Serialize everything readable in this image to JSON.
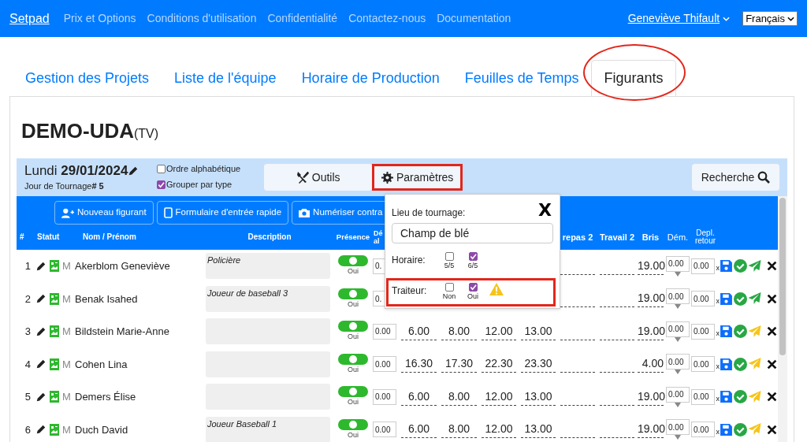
{
  "navbar": {
    "brand": "Setpad",
    "links": [
      "Prix et Options",
      "Conditions d'utilisation",
      "Confidentialité",
      "Contactez-nous",
      "Documentation"
    ],
    "user": "Geneviève Thifault",
    "language": "Français"
  },
  "tabs": [
    {
      "label": "Gestion des Projets",
      "selected": false
    },
    {
      "label": "Liste de l'équipe",
      "selected": false
    },
    {
      "label": "Horaire de Production",
      "selected": false
    },
    {
      "label": "Feuilles de Temps",
      "selected": false
    },
    {
      "label": "Figurants",
      "selected": true,
      "highlighted": true
    }
  ],
  "project": {
    "title": "DEMO-UDA",
    "type": "(TV)"
  },
  "day": {
    "date": "Lundi **29/01/2024**",
    "shoot_day": "Jour de Tournage**# 5**",
    "options": [
      {
        "label": "Ordre alphabétique",
        "checked": false
      },
      {
        "label": "Grouper par type",
        "checked": true
      }
    ]
  },
  "buttons": [
    {
      "kind": "tools",
      "label": "Outils",
      "highlighted": false
    },
    {
      "kind": "settings",
      "label": "Paramètres",
      "highlighted": true
    },
    {
      "kind": "search",
      "label": "Recherche",
      "highlighted": false
    }
  ],
  "toolbar": [
    {
      "kind": "add",
      "label": "Nouveau figurant"
    },
    {
      "kind": "tablet",
      "label": "Formulaire d'entrée rapide"
    },
    {
      "kind": "camera",
      "label": "Numériser contra"
    }
  ],
  "columns": [
    "#",
    "Statut",
    "Nom / Prénom",
    "Description",
    "Présence",
    "Dé al",
    "",
    "",
    "",
    "",
    "repas 2",
    "Travail 2",
    "Bris",
    "Dém.",
    "Depl. retour"
  ],
  "rows": [
    {
      "number": "1",
      "status": "M",
      "name": "Akerblom Geneviève",
      "description": "Policière",
      "present": true,
      "presence_label": "Oui",
      "start": "0.",
      "times": [],
      "bris": "19.00",
      "dem": "0.00",
      "depl": "0.00",
      "x": "x",
      "sent": true
    },
    {
      "number": "2",
      "status": "M",
      "name": "Benak Isahed",
      "description": "Joueur de baseball 3",
      "present": true,
      "presence_label": "Oui",
      "start": "0.",
      "times": [],
      "bris": "19.00",
      "dem": "0.00",
      "depl": "0.00",
      "x": "x",
      "sent": true
    },
    {
      "number": "3",
      "status": "M",
      "name": "Bildstein Marie-Anne",
      "description": "",
      "present": true,
      "presence_label": "Oui",
      "start": "0.00",
      "times": [
        "6.00",
        "8.00",
        "12.00",
        "13.00"
      ],
      "bris": "19.00",
      "dem": "0.00",
      "depl": "0.00",
      "x": "x",
      "sent": false
    },
    {
      "number": "4",
      "status": "M",
      "name": "Cohen Lina",
      "description": "",
      "present": true,
      "presence_label": "Oui",
      "start": "0.00",
      "times": [
        "16.30",
        "17.30",
        "22.30",
        "23.30"
      ],
      "bris": "4.00",
      "dem": "0.00",
      "depl": "0.00",
      "x": "x",
      "sent": false
    },
    {
      "number": "5",
      "status": "M",
      "name": "Demers Élise",
      "description": "",
      "present": true,
      "presence_label": "Oui",
      "start": "0.00",
      "times": [
        "6.00",
        "8.00",
        "12.00",
        "13.00"
      ],
      "bris": "19.00",
      "dem": "0.00",
      "depl": "0.00",
      "x": "x",
      "sent": false
    },
    {
      "number": "6",
      "status": "M",
      "name": "Duch David",
      "description": "Joueur Baseball 1",
      "present": true,
      "presence_label": "Oui",
      "start": "0.00",
      "times": [
        "6.00",
        "8.00",
        "12.00",
        "13.00"
      ],
      "bris": "19.00",
      "dem": "0.00",
      "depl": "0.00",
      "x": "x",
      "sent": false
    }
  ],
  "settings_popover": {
    "close": "X",
    "location_label": "Lieu de tournage:",
    "location_value": "Champ de blé",
    "groups": [
      {
        "label": "Horaire:",
        "highlighted": false,
        "warning": false,
        "options": [
          {
            "label": "5/5",
            "checked": false
          },
          {
            "label": "6/5",
            "checked": true
          }
        ]
      },
      {
        "label": "Traiteur:",
        "highlighted": true,
        "warning": true,
        "options": [
          {
            "label": "Non",
            "checked": false
          },
          {
            "label": "Oui",
            "checked": true
          }
        ]
      }
    ]
  }
}
